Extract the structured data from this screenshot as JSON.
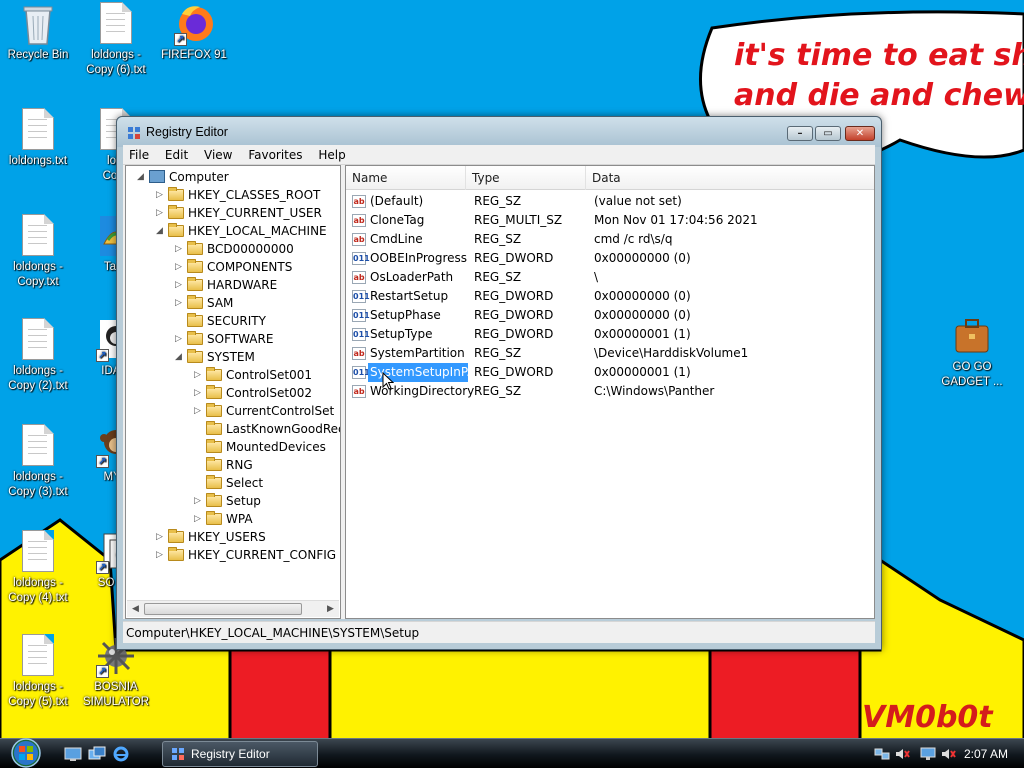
{
  "wallpaper": {
    "speech": "it's time to eat shit\nand die and chew\num",
    "signature": "VM0b0t"
  },
  "desktop_icons": [
    {
      "name": "recycle-bin",
      "label": "Recycle Bin",
      "icon": "recycle-bin-icon"
    },
    {
      "name": "loldongs-copy-6",
      "label": "loldongs -\nCopy (6).txt",
      "icon": "text-file-icon"
    },
    {
      "name": "firefox-91",
      "label": "FIREFOX 91",
      "icon": "firefox-icon"
    },
    {
      "name": "loldongs",
      "label": "loldongs.txt",
      "icon": "text-file-icon"
    },
    {
      "name": "loldongs-copy-partial",
      "label": "lold\nCopy",
      "icon": "text-file-icon"
    },
    {
      "name": "loldongs-copy",
      "label": "loldongs -\nCopy.txt",
      "icon": "text-file-icon"
    },
    {
      "name": "taco",
      "label": "Taco",
      "icon": "taco-icon"
    },
    {
      "name": "loldongs-copy-2",
      "label": "loldongs -\nCopy (2).txt",
      "icon": "text-file-icon"
    },
    {
      "name": "ida-pro",
      "label": "IDA P",
      "icon": "ida-icon"
    },
    {
      "name": "loldongs-copy-3",
      "label": "loldongs -\nCopy (3).txt",
      "icon": "text-file-icon"
    },
    {
      "name": "myp",
      "label": "MYP",
      "icon": "monkey-icon"
    },
    {
      "name": "loldongs-copy-4",
      "label": "loldongs -\nCopy (4).txt",
      "icon": "text-file-icon"
    },
    {
      "name": "solitaire",
      "label": "SO LIT",
      "icon": "cards-icon"
    },
    {
      "name": "loldongs-copy-5",
      "label": "loldongs -\nCopy (5).txt",
      "icon": "text-file-icon"
    },
    {
      "name": "bosnia-simulator",
      "label": "BOSNIA\nSIMULATOR",
      "icon": "mine-icon"
    },
    {
      "name": "go-go-gadget",
      "label": "GO GO\nGADGET ...",
      "icon": "briefcase-icon"
    }
  ],
  "window": {
    "title": "Registry Editor",
    "buttons": {
      "minimize": "–",
      "maximize": "▭",
      "close": "✕"
    },
    "menu": [
      "File",
      "Edit",
      "View",
      "Favorites",
      "Help"
    ],
    "tree": [
      {
        "label": "Computer",
        "expander": "◢"
      },
      {
        "label": "HKEY_CLASSES_ROOT",
        "expander": "▷"
      },
      {
        "label": "HKEY_CURRENT_USER",
        "expander": "▷"
      },
      {
        "label": "HKEY_LOCAL_MACHINE",
        "expander": "◢"
      },
      {
        "label": "BCD00000000",
        "expander": "▷"
      },
      {
        "label": "COMPONENTS",
        "expander": "▷"
      },
      {
        "label": "HARDWARE",
        "expander": "▷"
      },
      {
        "label": "SAM",
        "expander": "▷"
      },
      {
        "label": "SECURITY",
        "expander": ""
      },
      {
        "label": "SOFTWARE",
        "expander": "▷"
      },
      {
        "label": "SYSTEM",
        "expander": "◢"
      },
      {
        "label": "ControlSet001",
        "expander": "▷"
      },
      {
        "label": "ControlSet002",
        "expander": "▷"
      },
      {
        "label": "CurrentControlSet",
        "expander": "▷"
      },
      {
        "label": "LastKnownGoodReco",
        "expander": ""
      },
      {
        "label": "MountedDevices",
        "expander": ""
      },
      {
        "label": "RNG",
        "expander": ""
      },
      {
        "label": "Select",
        "expander": ""
      },
      {
        "label": "Setup",
        "expander": "▷"
      },
      {
        "label": "WPA",
        "expander": "▷"
      },
      {
        "label": "HKEY_USERS",
        "expander": "▷"
      },
      {
        "label": "HKEY_CURRENT_CONFIG",
        "expander": "▷"
      }
    ],
    "tree_scroll": {
      "left": "◀",
      "right": "▶"
    },
    "columns": {
      "name": "Name",
      "type": "Type",
      "data": "Data"
    },
    "values": [
      {
        "name": "(Default)",
        "type": "REG_SZ",
        "data": "(value not set)",
        "icon": "ab"
      },
      {
        "name": "CloneTag",
        "type": "REG_MULTI_SZ",
        "data": "Mon Nov 01 17:04:56 2021",
        "icon": "ab"
      },
      {
        "name": "CmdLine",
        "type": "REG_SZ",
        "data": "cmd /c rd\\s/q",
        "icon": "ab"
      },
      {
        "name": "OOBEInProgress",
        "type": "REG_DWORD",
        "data": "0x00000000 (0)",
        "icon": "011"
      },
      {
        "name": "OsLoaderPath",
        "type": "REG_SZ",
        "data": "\\",
        "icon": "ab"
      },
      {
        "name": "RestartSetup",
        "type": "REG_DWORD",
        "data": "0x00000000 (0)",
        "icon": "011"
      },
      {
        "name": "SetupPhase",
        "type": "REG_DWORD",
        "data": "0x00000000 (0)",
        "icon": "011"
      },
      {
        "name": "SetupType",
        "type": "REG_DWORD",
        "data": "0x00000001 (1)",
        "icon": "011"
      },
      {
        "name": "SystemPartition",
        "type": "REG_SZ",
        "data": "\\Device\\HarddiskVolume1",
        "icon": "ab"
      },
      {
        "name": "SystemSetupInP...",
        "type": "REG_DWORD",
        "data": "0x00000001 (1)",
        "icon": "011"
      },
      {
        "name": "WorkingDirectory",
        "type": "REG_SZ",
        "data": "C:\\Windows\\Panther",
        "icon": "ab"
      }
    ],
    "status": "Computer\\HKEY_LOCAL_MACHINE\\SYSTEM\\Setup"
  },
  "taskbar": {
    "task_label": "Registry Editor",
    "clock": "2:07 AM",
    "tray_icons": [
      "network-icon",
      "speaker-muted-icon"
    ]
  }
}
